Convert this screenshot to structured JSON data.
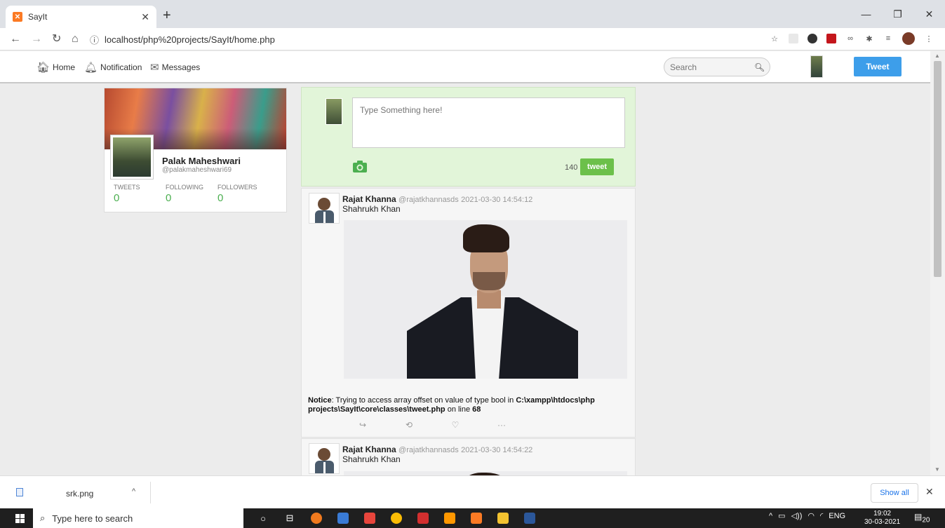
{
  "browser": {
    "tab_title": "SayIt",
    "tab_favicon_glyph": "✕",
    "new_tab": "+",
    "url": "localhost/php%20projects/SayIt/home.php",
    "win_minimize": "—",
    "win_maximize": "❐",
    "win_close": "✕"
  },
  "header": {
    "nav": [
      {
        "label": "Home",
        "icon": "home-icon"
      },
      {
        "label": "Notification",
        "icon": "bell-icon"
      },
      {
        "label": "Messages",
        "icon": "envelope-icon"
      }
    ],
    "search_placeholder": "Search",
    "tweet_button": "Tweet"
  },
  "profile": {
    "name": "Palak Maheshwari",
    "handle": "@palakmaheshwari69",
    "stats": [
      {
        "label": "TWEETS",
        "value": "0"
      },
      {
        "label": "FOLLOWING",
        "value": "0"
      },
      {
        "label": "FOLLOWERS",
        "value": "0"
      }
    ]
  },
  "compose": {
    "placeholder": "Type Something here!",
    "char_count": "140",
    "button": "tweet"
  },
  "tweets": [
    {
      "author": "Rajat Khanna",
      "handle": "@rajatkhannasds",
      "time": "2021-03-30 14:54:12",
      "text": "Shahrukh Khan",
      "notice_label": "Notice",
      "notice_msg": ": Trying to access array offset on value of type bool in ",
      "notice_path": "C:\\xampp\\htdocs\\php projects\\SayIt\\core\\classes\\tweet.php",
      "notice_on": " on line ",
      "notice_line": "68",
      "actions": [
        "↪",
        "⟲",
        "♡",
        "···"
      ]
    },
    {
      "author": "Rajat Khanna",
      "handle": "@rajatkhannasds",
      "time": "2021-03-30 14:54:22",
      "text": "Shahrukh Khan"
    }
  ],
  "downloads": {
    "file_name": "srk.png",
    "show_all": "Show all"
  },
  "taskbar": {
    "search_text": "Type here to search",
    "tray_lang": "ENG",
    "time": "19:02",
    "date": "30-03-2021",
    "notif_count": "20"
  }
}
